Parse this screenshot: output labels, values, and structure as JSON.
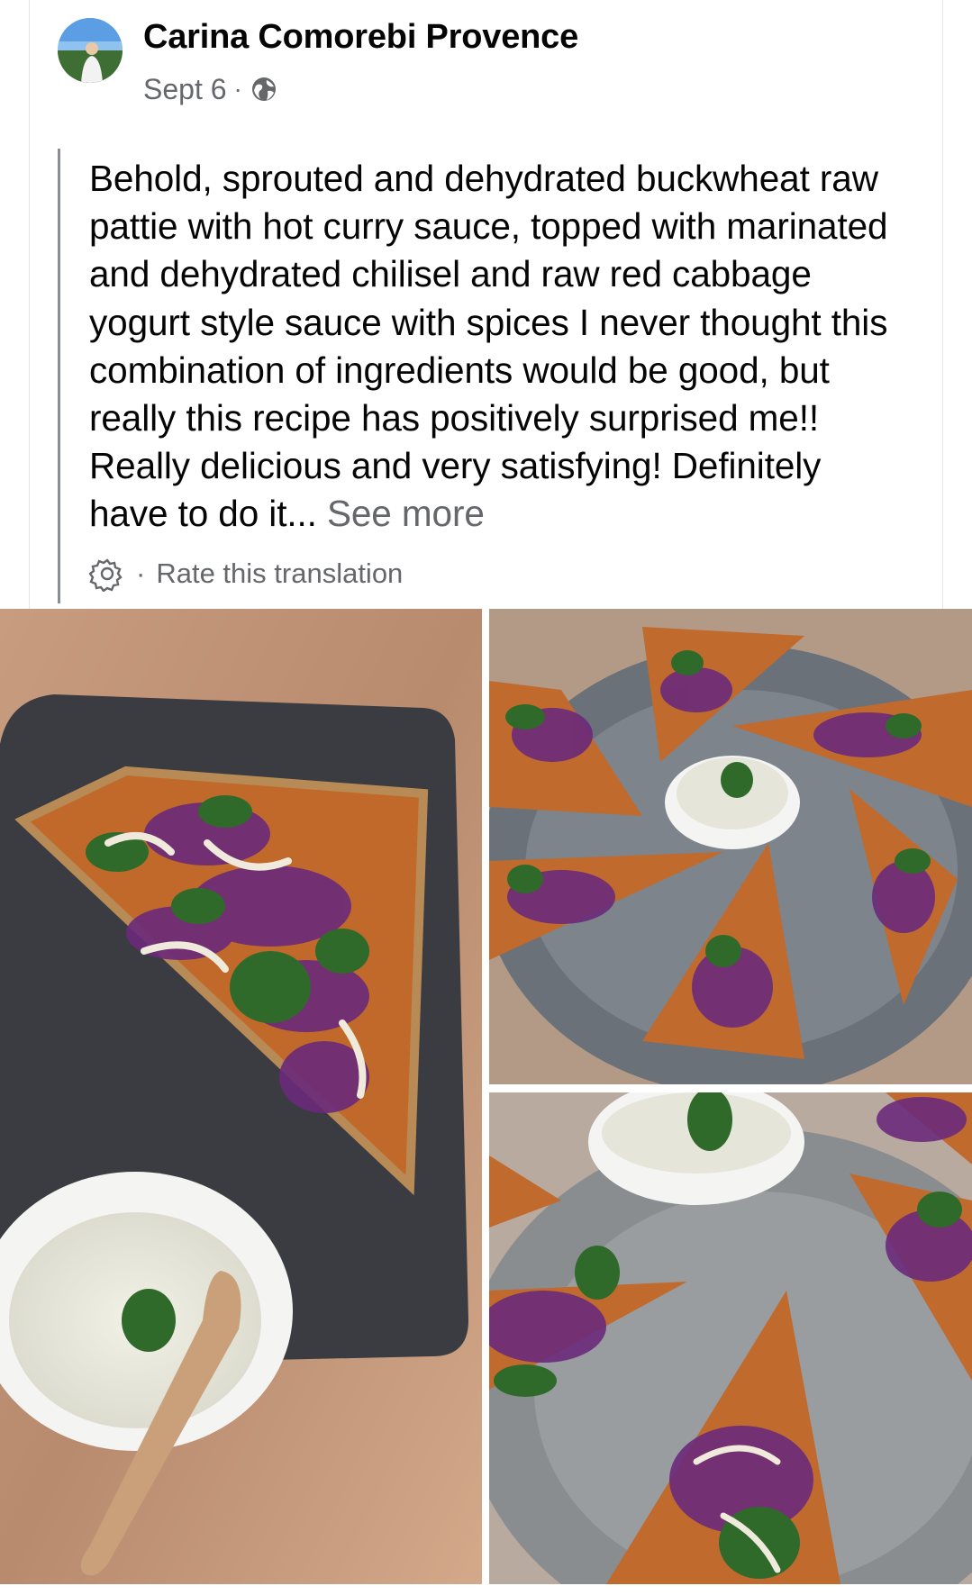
{
  "post": {
    "author": "Carina Comorebi Provence",
    "date": "Sept 6",
    "separator": "·",
    "privacy_icon": "globe-icon",
    "text": "Behold, sprouted and dehydrated buckwheat raw pattie with hot curry sauce, topped with marinated and dehydrated chilisel and raw red cabbage yogurt style sauce with spices I never thought this combination of ingredients would be good, but really this recipe has positively surprised me!! Really delicious and very satisfying! Definitely have to do it...",
    "see_more": "See more",
    "translation_settings_icon": "gear-icon",
    "rate_translation": "Rate this translation"
  },
  "photos": [
    {
      "name": "photo-slate-pattie"
    },
    {
      "name": "photo-plate-wedges-top"
    },
    {
      "name": "photo-plate-wedges-closeup"
    }
  ]
}
